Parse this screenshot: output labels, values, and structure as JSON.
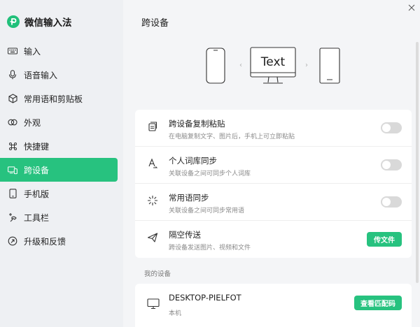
{
  "app": {
    "title": "微信输入法"
  },
  "sidebar": {
    "items": [
      {
        "label": "输入",
        "icon": "keyboard-icon",
        "active": false
      },
      {
        "label": "语音输入",
        "icon": "microphone-icon",
        "active": false
      },
      {
        "label": "常用语和剪贴板",
        "icon": "cube-icon",
        "active": false
      },
      {
        "label": "外观",
        "icon": "appearance-icon",
        "active": false
      },
      {
        "label": "快捷键",
        "icon": "command-icon",
        "active": false
      },
      {
        "label": "跨设备",
        "icon": "devices-icon",
        "active": true
      },
      {
        "label": "手机版",
        "icon": "phone-icon",
        "active": false
      },
      {
        "label": "工具栏",
        "icon": "toolbar-icon",
        "active": false
      },
      {
        "label": "升级和反馈",
        "icon": "upgrade-icon",
        "active": false
      }
    ]
  },
  "main": {
    "title": "跨设备",
    "illustration": {
      "monitor_text": "Text",
      "arrow_left": "‹",
      "arrow_right": "›"
    },
    "features": [
      {
        "title": "跨设备复制粘贴",
        "desc": "在电脑复制文字、图片后，手机上可立即粘贴",
        "control": "toggle",
        "enabled": false,
        "icon": "clipboard-icon"
      },
      {
        "title": "个人词库同步",
        "desc": "关联设备之间可同步个人词库",
        "control": "toggle",
        "enabled": false,
        "icon": "font-sync-icon"
      },
      {
        "title": "常用语同步",
        "desc": "关联设备之间可同步常用语",
        "control": "toggle",
        "enabled": false,
        "icon": "sparkle-icon"
      },
      {
        "title": "隔空传送",
        "desc": "跨设备发送图片、视频和文件",
        "control": "button",
        "button_label": "传文件",
        "icon": "send-icon"
      }
    ],
    "my_devices_label": "我的设备",
    "device": {
      "name": "DESKTOP-PIELFOT",
      "sub": "本机",
      "button_label": "查看匹配码",
      "icon": "monitor-icon"
    }
  },
  "colors": {
    "accent": "#27c27f",
    "sidebar_bg": "#eef0f3",
    "main_bg": "#f4f5f7"
  }
}
